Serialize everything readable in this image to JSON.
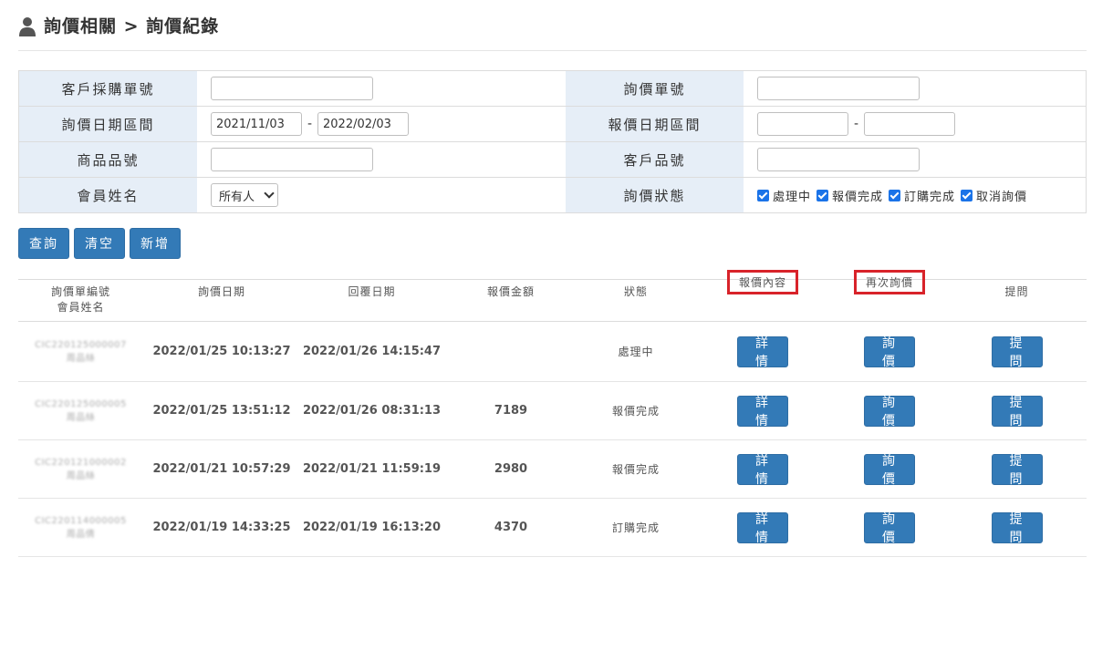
{
  "header": {
    "title": "詢價相關 > 詢價紀錄"
  },
  "form": {
    "customer_po_label": "客戶採購單號",
    "customer_po_value": "",
    "inquiry_no_label": "詢價單號",
    "inquiry_no_value": "",
    "inquiry_date_label": "詢價日期區間",
    "inquiry_date_from": "2021/11/03",
    "inquiry_date_to": "2022/02/03",
    "quote_date_label": "報價日期區間",
    "quote_date_from": "",
    "quote_date_to": "",
    "product_no_label": "商品品號",
    "product_no_value": "",
    "customer_part_label": "客戶品號",
    "customer_part_value": "",
    "member_label": "會員姓名",
    "member_selected": "所有人",
    "status_label": "詢價狀態",
    "dash": "-",
    "status_options": [
      "處理中",
      "報價完成",
      "訂購完成",
      "取消詢價"
    ]
  },
  "buttons": {
    "query": "查詢",
    "clear": "清空",
    "add": "新增"
  },
  "table": {
    "headers": {
      "id_line1": "詢價單編號",
      "id_line2": "會員姓名",
      "inquiry_date": "詢價日期",
      "reply_date": "回覆日期",
      "amount": "報價金額",
      "status": "狀態",
      "detail": "報價內容",
      "reinquire": "再次詢價",
      "question": "提問"
    },
    "action_labels": {
      "detail": "詳情",
      "reinquire": "詢價",
      "question": "提問"
    },
    "rows": [
      {
        "id": "CIC220125000007",
        "member": "周品絲",
        "inquiry_date": "2022/01/25 10:13:27",
        "reply_date": "2022/01/26 14:15:47",
        "amount": "",
        "status": "處理中"
      },
      {
        "id": "CIC220125000005",
        "member": "周品絲",
        "inquiry_date": "2022/01/25 13:51:12",
        "reply_date": "2022/01/26 08:31:13",
        "amount": "7189",
        "status": "報價完成"
      },
      {
        "id": "CIC220121000002",
        "member": "周品絲",
        "inquiry_date": "2022/01/21 10:57:29",
        "reply_date": "2022/01/21 11:59:19",
        "amount": "2980",
        "status": "報價完成"
      },
      {
        "id": "CIC220114000005",
        "member": "周品倩",
        "inquiry_date": "2022/01/19 14:33:25",
        "reply_date": "2022/01/19 16:13:20",
        "amount": "4370",
        "status": "訂購完成"
      }
    ]
  },
  "colors": {
    "button": "#337ab7",
    "label_bg": "#e6eef7",
    "highlight": "#d8232a",
    "checkbox": "#1a73e8"
  }
}
